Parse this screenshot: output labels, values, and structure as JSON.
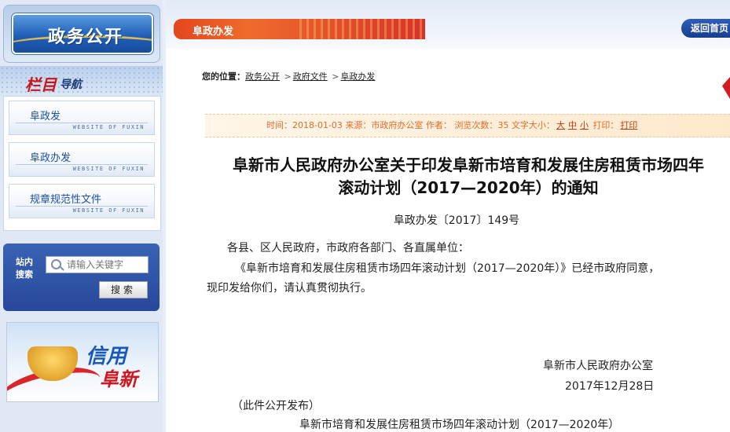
{
  "sidebar": {
    "banner_title": "政务公开",
    "nav_title_main": "栏目",
    "nav_title_sub": "导航",
    "items": [
      {
        "label": "阜政发",
        "sub": "WEBSITE OF FUXIN"
      },
      {
        "label": "阜政办发",
        "sub": "WEBSITE OF FUXIN"
      },
      {
        "label": "规章规范性文件",
        "sub": "WEBSITE OF FUXIN"
      }
    ],
    "search": {
      "label": "站内搜索",
      "placeholder": "请输入关键字",
      "button": "搜索"
    },
    "credit": {
      "line1": "信用",
      "line2": "阜新"
    }
  },
  "header": {
    "section_tab": "阜政办发",
    "back_home": "返回首页"
  },
  "breadcrumb": {
    "prefix": "您的位置：",
    "items": [
      "政务公开",
      "政府文件",
      "阜政办发"
    ],
    "separator": ">"
  },
  "meta": {
    "time_label": "时间：",
    "time": "2018-01-03",
    "source_label": "来源：",
    "source": "市政府办公室",
    "author_label": "作者：",
    "views_label": "浏览次数：",
    "views": "35",
    "fontsize_label": "文字大小：",
    "size_large": "大",
    "size_medium": "中",
    "size_small": "小",
    "print_label": "打印：",
    "print_link": "打印"
  },
  "document": {
    "title_line1": "阜新市人民政府办公室关于印发阜新市培育和发展住房租赁市场四年",
    "title_line2": "滚动计划（2017—2020年）的通知",
    "number": "阜政办发〔2017〕149号",
    "addressee": "各县、区人民政府，市政府各部门、各直属单位：",
    "body_line1": "《阜新市培育和发展住房租赁市场四年滚动计划（2017—2020年）》已经市政府同意，",
    "body_line2": "现印发给你们，请认真贯彻执行。",
    "sign_org": "阜新市人民政府办公室",
    "sign_date": "2017年12月28日",
    "public_note": "（此件公开发布）",
    "attachment_title": "阜新市培育和发展住房租赁市场四年滚动计划（2017—2020年）"
  }
}
